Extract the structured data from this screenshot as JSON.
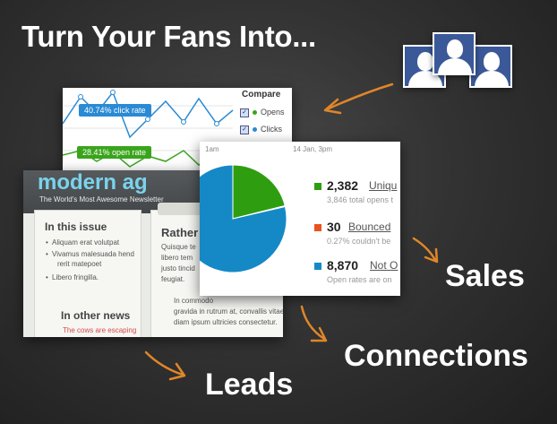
{
  "headline": "Turn Your Fans Into...",
  "outcomes": {
    "sales": "Sales",
    "connections": "Connections",
    "leads": "Leads"
  },
  "colors": {
    "orange_arrow": "#e0862a",
    "fb_blue": "#3b5998",
    "pie_green": "#2e9e10",
    "pie_blue": "#1589c6",
    "bounced_orange": "#e8531e",
    "click_blue": "#2a8ad4",
    "open_green": "#3aa51c"
  },
  "line_chart_card": {
    "click_rate_label": "40.74% click rate",
    "open_rate_label": "28.41% open rate",
    "compare_title": "Compare",
    "compare_items": [
      "Opens",
      "Clicks"
    ]
  },
  "newsletter_card": {
    "logo": "modern ag",
    "tagline": "The World's Most Awesome Newsletter",
    "in_this_issue": "In this issue",
    "bullets": [
      "Aliquam erat volutpat",
      "Vivamus malesuada hend",
      "rerit matepoet",
      "Libero fringilla."
    ],
    "in_other_news": "In other news",
    "news_item": "The cows are escaping",
    "right_heading": "Rather c",
    "right_lines": [
      "Quisque te",
      "libero tem",
      "justo tincid",
      "feugiat.",
      "In commodo",
      "gravida in rutrum at, convallis vitae",
      "diam ipsum ultricies consectetur."
    ]
  },
  "pie_card": {
    "time_left": "1am",
    "time_right": "14 Jan, 3pm",
    "stats": [
      {
        "number": "2,382",
        "label": "Uniqu",
        "sub": "3,846 total opens t"
      },
      {
        "number": "30",
        "label": "Bounced",
        "sub": "0.27% couldn't be"
      },
      {
        "number": "8,870",
        "label": "Not O",
        "sub": "Open rates are on"
      }
    ]
  },
  "chart_data": {
    "type": "pie",
    "labels": [
      "Unique opens",
      "Bounced",
      "Not opened"
    ],
    "values": [
      2382,
      30,
      8870
    ]
  }
}
